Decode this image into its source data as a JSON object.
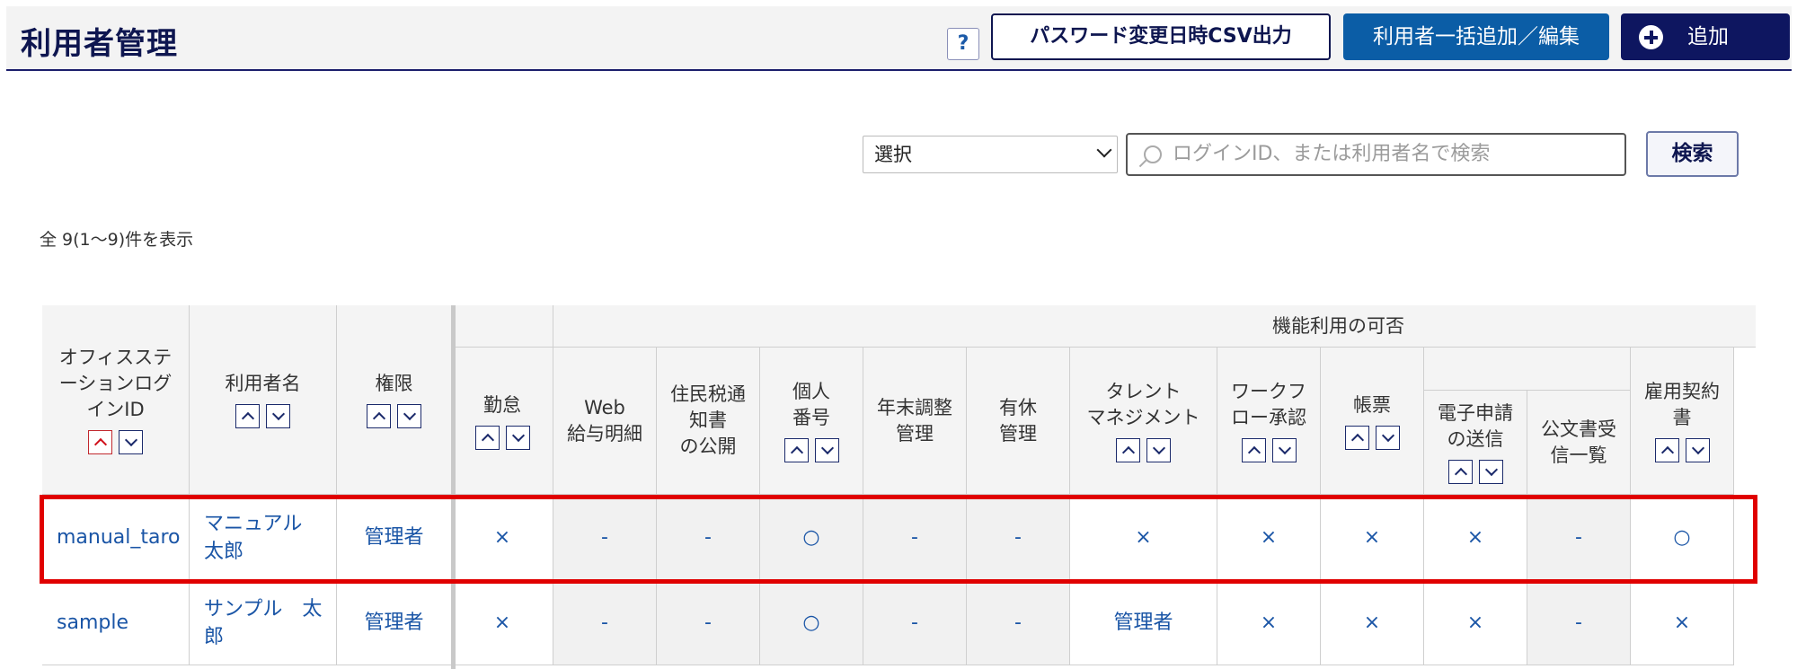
{
  "header": {
    "title": "利用者管理",
    "help_label": "?",
    "csv_button": "パスワード変更日時CSV出力",
    "bulk_button": "利用者一括追加／編集",
    "add_button": "追加"
  },
  "search": {
    "select_value": "選択",
    "placeholder": "ログインID、または利用者名で検索",
    "button": "検索"
  },
  "count_text": "全 9(1～9)件を表示",
  "table": {
    "group_header": "機能利用の可否",
    "columns": [
      {
        "key": "login_id",
        "label": "オフィスステ\nーションログ\nインID"
      },
      {
        "key": "name",
        "label": "利用者名"
      },
      {
        "key": "role",
        "label": "権限"
      },
      {
        "key": "attendance",
        "label": "勤怠"
      },
      {
        "key": "web_payslip",
        "label": "Web\n給与明細"
      },
      {
        "key": "resident_tax",
        "label": "住民税通\n知書\nの公開"
      },
      {
        "key": "my_number",
        "label": "個人\n番号"
      },
      {
        "key": "year_end",
        "label": "年末調整\n管理"
      },
      {
        "key": "paid_leave",
        "label": "有休\n管理"
      },
      {
        "key": "talent",
        "label": "タレント\nマネジメント"
      },
      {
        "key": "workflow",
        "label": "ワークフ\nロー承認"
      },
      {
        "key": "forms",
        "label": "帳票"
      },
      {
        "key": "e_application",
        "label": "電子申請\nの送信"
      },
      {
        "key": "official_docs",
        "label": "公文書受\n信一覧"
      },
      {
        "key": "employment_contract",
        "label": "雇用契約\n書"
      }
    ],
    "rows": [
      {
        "cells": [
          "manual_taro",
          "マニュアル\n太郎",
          "管理者",
          "×",
          "-",
          "-",
          "○",
          "-",
          "-",
          "×",
          "×",
          "×",
          "×",
          "-",
          "○"
        ]
      },
      {
        "cells": [
          "sample",
          "サンプル　太\n郎",
          "管理者",
          "×",
          "-",
          "-",
          "○",
          "-",
          "-",
          "管理者",
          "×",
          "×",
          "×",
          "-",
          "×"
        ]
      }
    ]
  },
  "colors": {
    "navy": "#0e1650",
    "blue_button": "#0b5da6",
    "link_blue": "#1a55a6",
    "highlight_red": "#e00000"
  }
}
